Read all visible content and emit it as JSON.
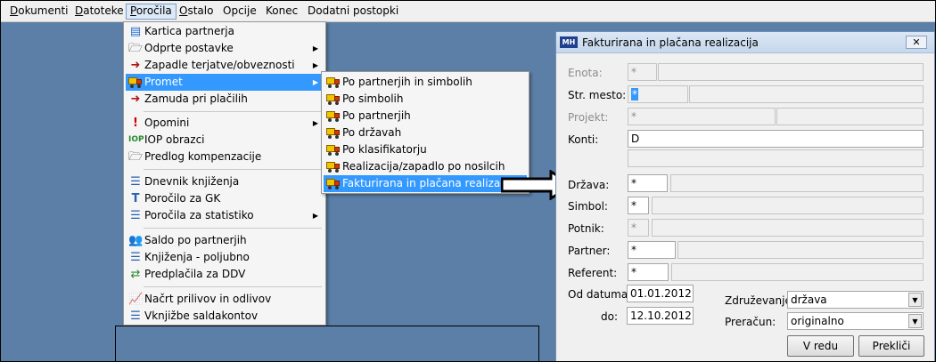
{
  "menubar": {
    "items": [
      {
        "label": "Dokumenti",
        "acc": "D",
        "rest": "okumenti"
      },
      {
        "label": "Datoteke",
        "acc": "D",
        "rest": "atoteke"
      },
      {
        "label": "Poročila",
        "acc": "P",
        "rest": "oročila"
      },
      {
        "label": "Ostalo",
        "acc": "O",
        "rest": "stalo"
      },
      {
        "label": "Opcije",
        "acc": "",
        "rest": "Opcije"
      },
      {
        "label": "Konec",
        "acc": "",
        "rest": "Konec"
      },
      {
        "label": "Dodatni postopki",
        "acc": "",
        "rest": "Dodatni postopki"
      }
    ]
  },
  "porocila_menu": {
    "items": [
      "Kartica partnerja",
      "Odprte postavke",
      "Zapadle terjatve/obveznosti",
      "Promet",
      "Zamuda pri plačilih",
      "Opomini",
      "IOP obrazci",
      "Predlog kompenzacije",
      "Dnevnik knjiženja",
      "Poročilo za GK",
      "Poročila za statistiko",
      "Saldo po partnerjih",
      "Knjiženja - poljubno",
      "Predplačila za DDV",
      "Načrt prilivov in odlivov",
      "Vknjižbe saldakontov"
    ]
  },
  "promet_menu": {
    "items": [
      "Po partnerjih in simbolih",
      "Po simbolih",
      "Po partnerjih",
      "Po državah",
      "Po klasifikatorju",
      "Realizacija/zapadlo po nosilcih",
      "Fakturirana in plačana realizacija"
    ]
  },
  "dialog": {
    "title": "Fakturirana in plačana realizacija",
    "logo": "MH",
    "close": "✕",
    "labels": {
      "enota": "Enota:",
      "str_mesto": "Str. mesto:",
      "projekt": "Projekt:",
      "konti": "Konti:",
      "drzava": "Država:",
      "simbol": "Simbol:",
      "potnik": "Potnik:",
      "partner": "Partner:",
      "referent": "Referent:",
      "od_datuma": "Od datuma:",
      "do": "do:",
      "zdruzevanje": "Združevanje:",
      "preracun": "Preračun:"
    },
    "values": {
      "enota": "*",
      "str_mesto": "*",
      "projekt": "*",
      "konti": "D",
      "drzava": "*",
      "simbol": "*",
      "potnik": "*",
      "partner": "*",
      "referent": "*",
      "od_datuma": "01.01.2012",
      "do": "12.10.2012",
      "zdruzevanje": "država",
      "preracun": "originalno"
    },
    "buttons": {
      "ok": "V redu",
      "cancel": "Prekliči"
    }
  },
  "colors": {
    "desktop": "#5b7fa7",
    "highlight": "#3399ff"
  }
}
